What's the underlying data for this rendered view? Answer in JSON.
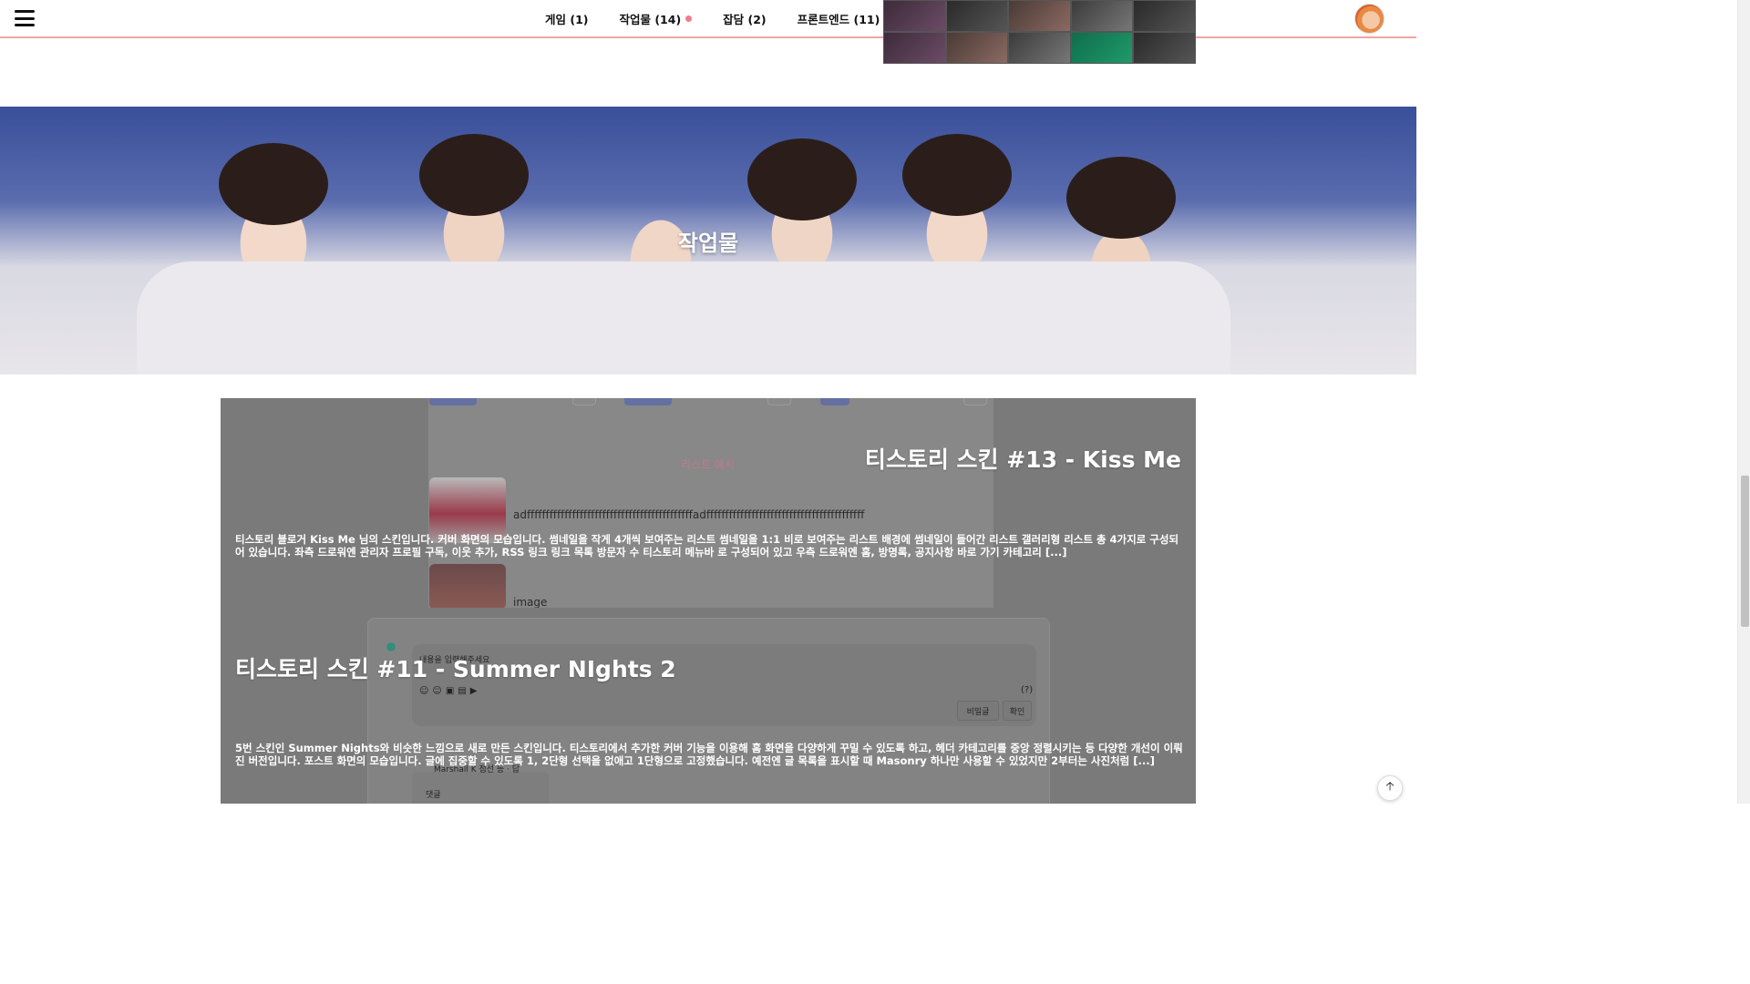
{
  "header": {
    "nav": [
      {
        "label": "게임 (1)",
        "has_dot": false
      },
      {
        "label": "작업물 (14)",
        "has_dot": true
      },
      {
        "label": "잡담 (2)",
        "has_dot": false
      },
      {
        "label": "프론트엔드 (11)",
        "has_dot": true
      }
    ],
    "icons": {
      "menu": "hamburger-menu-icon",
      "avatar": "profile-avatar"
    },
    "accent_color": "#f27c8b"
  },
  "hero": {
    "title": "작업물"
  },
  "posts": [
    {
      "title": "티스토리 스킨 #13 - Kiss Me",
      "excerpt": "티스토리 블로거 Kiss Me 님의 스킨입니다. 커버 화면의 모습입니다. 썸네일을 작게 4개씩 보여주는 리스트 썸네일을 1:1 비로 보여주는 리스트 배경에 썸네일이 들어간 리스트 갤러리형 리스트 총 4가지로 구성되어 있습니다. 좌측 드로워엔 관리자 프로필 구독, 이웃 추가, RSS 링크 링크 목록 방문자 수 티스토리 메뉴바 로 구성되어 있고 우측 드로워엔 홈, 방명록, 공지사항 바로 가기 카테고리 [...]",
      "bg": {
        "list_label": "리스트 예시",
        "row1_text": "adffffffffffffffffffffffffffffffffffffffffffffadffffffffffffffffffffffffffffffffffffffffff",
        "row2_text": "image"
      }
    },
    {
      "title": "티스토리 스킨 #11 - Summer NIghts 2",
      "excerpt": "5번 스킨인 Summer Nights와 비슷한 느낌으로 새로 만든 스킨입니다. 티스토리에서 추가한 커버 기능을 이용해 홈 화면을 다양하게 꾸밀 수 있도록 하고, 헤더 카테고리를 중앙 정렬시키는 등 다양한 개선이 이뤄진 버전입니다. 포스트 화면의 모습입니다. 글에 집중할 수 있도록 1, 2단형 선택을 없애고 1단형으로 고정했습니다. 예전엔 글 목록을 표시할 때 Masonry 하나만 사용할 수 있었지만 2부터는 사진처럼 [...]",
      "bg": {
        "placeholder": "내용을 입력해주세요",
        "help": "(?)",
        "secret": "비밀글",
        "confirm": "확인",
        "commenter": "Marshall K 점선 등 · 답",
        "reply": "댓글"
      }
    }
  ],
  "scroll_top_icon": "arrow-up-icon"
}
